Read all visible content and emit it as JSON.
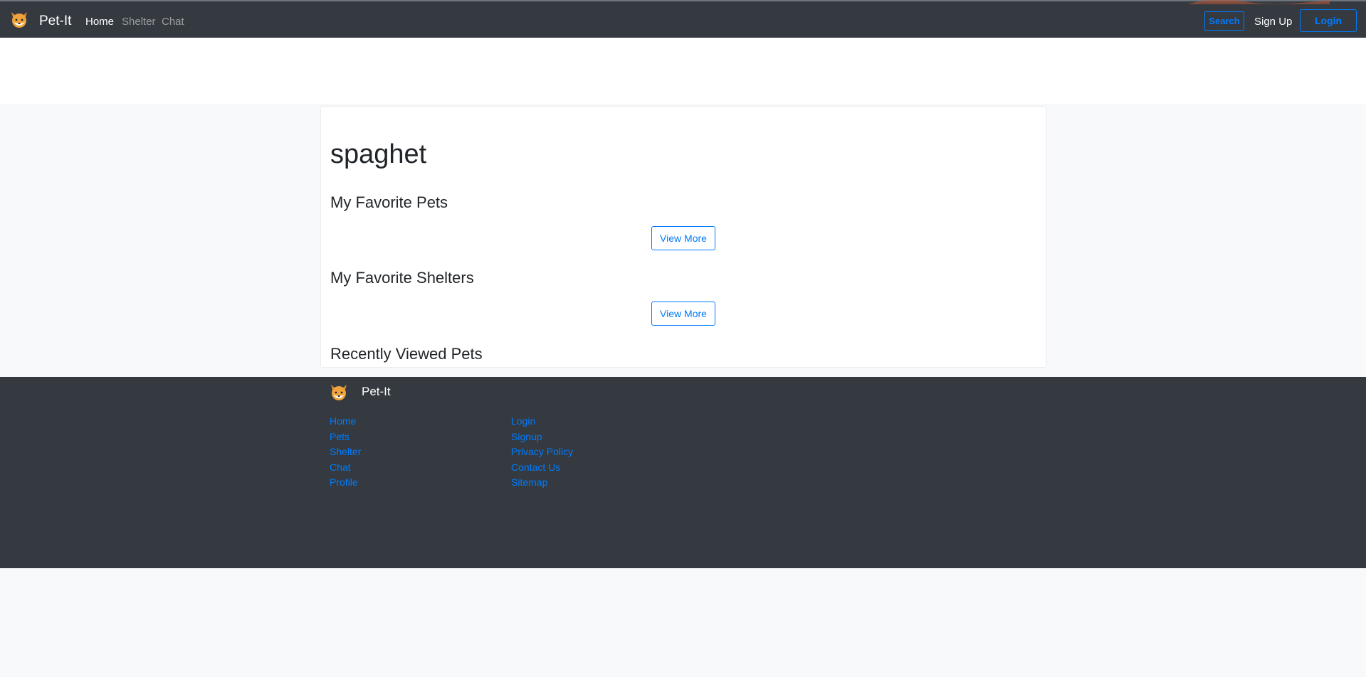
{
  "navbar": {
    "brand": "Pet-It",
    "links": [
      {
        "label": "Home",
        "active": true
      },
      {
        "label": "Shelter",
        "active": false
      },
      {
        "label": "Chat",
        "active": false
      }
    ],
    "search_label": "Search",
    "signup_label": "Sign Up",
    "login_label": "Login",
    "logo_icon": "fox-face-icon"
  },
  "profile": {
    "name": "spaghet",
    "sections": [
      {
        "title": "My Favorite Pets",
        "button": "View More"
      },
      {
        "title": "My Favorite Shelters",
        "button": "View More"
      },
      {
        "title": "Recently Viewed Pets"
      }
    ]
  },
  "footer": {
    "brand": "Pet-It",
    "col1": [
      "Home",
      "Pets",
      "Shelter",
      "Chat",
      "Profile"
    ],
    "col2": [
      "Login",
      "Signup",
      "Privacy Policy",
      "Contact Us",
      "Sitemap"
    ]
  },
  "colors": {
    "navbar_bg": "#343a40",
    "primary": "#007bff",
    "page_bg": "#f8f9fa"
  }
}
